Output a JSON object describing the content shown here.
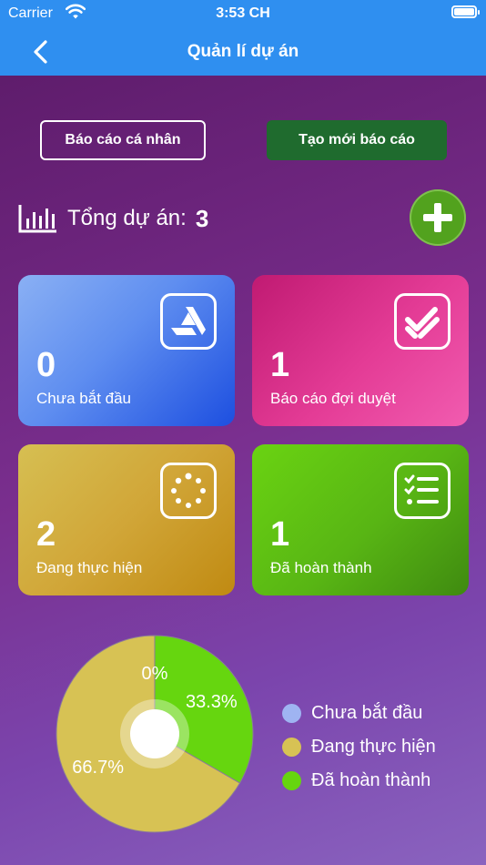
{
  "status_bar": {
    "carrier": "Carrier",
    "time": "3:53 CH"
  },
  "nav": {
    "title": "Quản lí dự án",
    "back_icon": "chevron-left-icon"
  },
  "buttons": {
    "personal_report": "Báo cáo cá nhân",
    "create_report": "Tạo mới báo cáo"
  },
  "summary": {
    "label": "Tổng dự án:",
    "count": "3"
  },
  "cards": [
    {
      "value": "0",
      "caption": "Chưa bắt đầu",
      "icon": "artstation-icon"
    },
    {
      "value": "1",
      "caption": "Báo cáo đợi duyệt",
      "icon": "double-check-icon"
    },
    {
      "value": "2",
      "caption": "Đang thực hiện",
      "icon": "spinner-icon"
    },
    {
      "value": "1",
      "caption": "Đã hoàn thành",
      "icon": "checklist-icon"
    }
  ],
  "colors": {
    "nav_bg": "#2f8ff0",
    "create_btn": "#1f6b2e",
    "add_btn": "#52a21e",
    "not_started": "#9fb4f2",
    "in_progress": "#d7c254",
    "completed": "#66d60f"
  },
  "chart_data": {
    "type": "pie",
    "categories": [
      "Chưa bắt đầu",
      "Đang thực hiện",
      "Đã hoàn thành"
    ],
    "values": [
      0,
      2,
      1
    ],
    "labels": [
      "0%",
      "66.7%",
      "33.3%"
    ],
    "colors": [
      "#9fb4f2",
      "#d7c254",
      "#66d60f"
    ],
    "legend_position": "right"
  }
}
